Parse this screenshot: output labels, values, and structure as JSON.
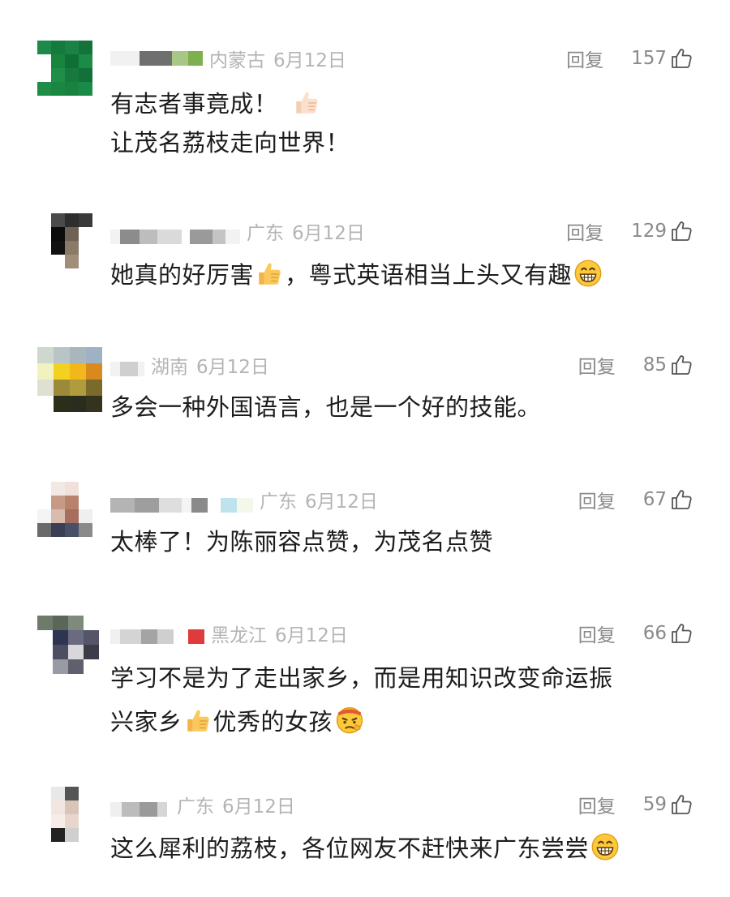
{
  "comments": [
    {
      "location": "内蒙古",
      "date": "6月12日",
      "reply_label": "回复",
      "likes": "157",
      "lines": [
        "有志者事竟成！",
        "让茂名荔枝走向世界！"
      ]
    },
    {
      "location": "广东",
      "date": "6月12日",
      "reply_label": "回复",
      "likes": "129",
      "lines": [
        "她真的好厉害",
        "，粤式英语相当上头又有趣"
      ]
    },
    {
      "location": "湖南",
      "date": "6月12日",
      "reply_label": "回复",
      "likes": "85",
      "lines": [
        "多会一种外国语言，也是一个好的技能。"
      ]
    },
    {
      "location": "广东",
      "date": "6月12日",
      "reply_label": "回复",
      "likes": "67",
      "lines": [
        "太棒了！为陈丽容点赞，为茂名点赞"
      ]
    },
    {
      "location": "黑龙江",
      "date": "6月12日",
      "reply_label": "回复",
      "likes": "66",
      "lines": [
        "学习不是为了走出家乡，而是用知识改变命运振",
        "兴家乡",
        "优秀的女孩"
      ]
    },
    {
      "location": "广东",
      "date": "6月12日",
      "reply_label": "回复",
      "likes": "59",
      "lines": [
        "这么犀利的荔枝，各位网友不赶快来广东尝尝"
      ]
    }
  ],
  "icons": {
    "like": "thumbs-up-outline-icon",
    "thumbs_up_emoji": "thumbs-up-emoji",
    "grin_emoji": "grinning-face-emoji",
    "determined_emoji": "determined-face-emoji"
  },
  "colors": {
    "meta_text": "#b4b4b4",
    "action_text": "#8a8a8a",
    "body_text": "#1c1c1c"
  }
}
